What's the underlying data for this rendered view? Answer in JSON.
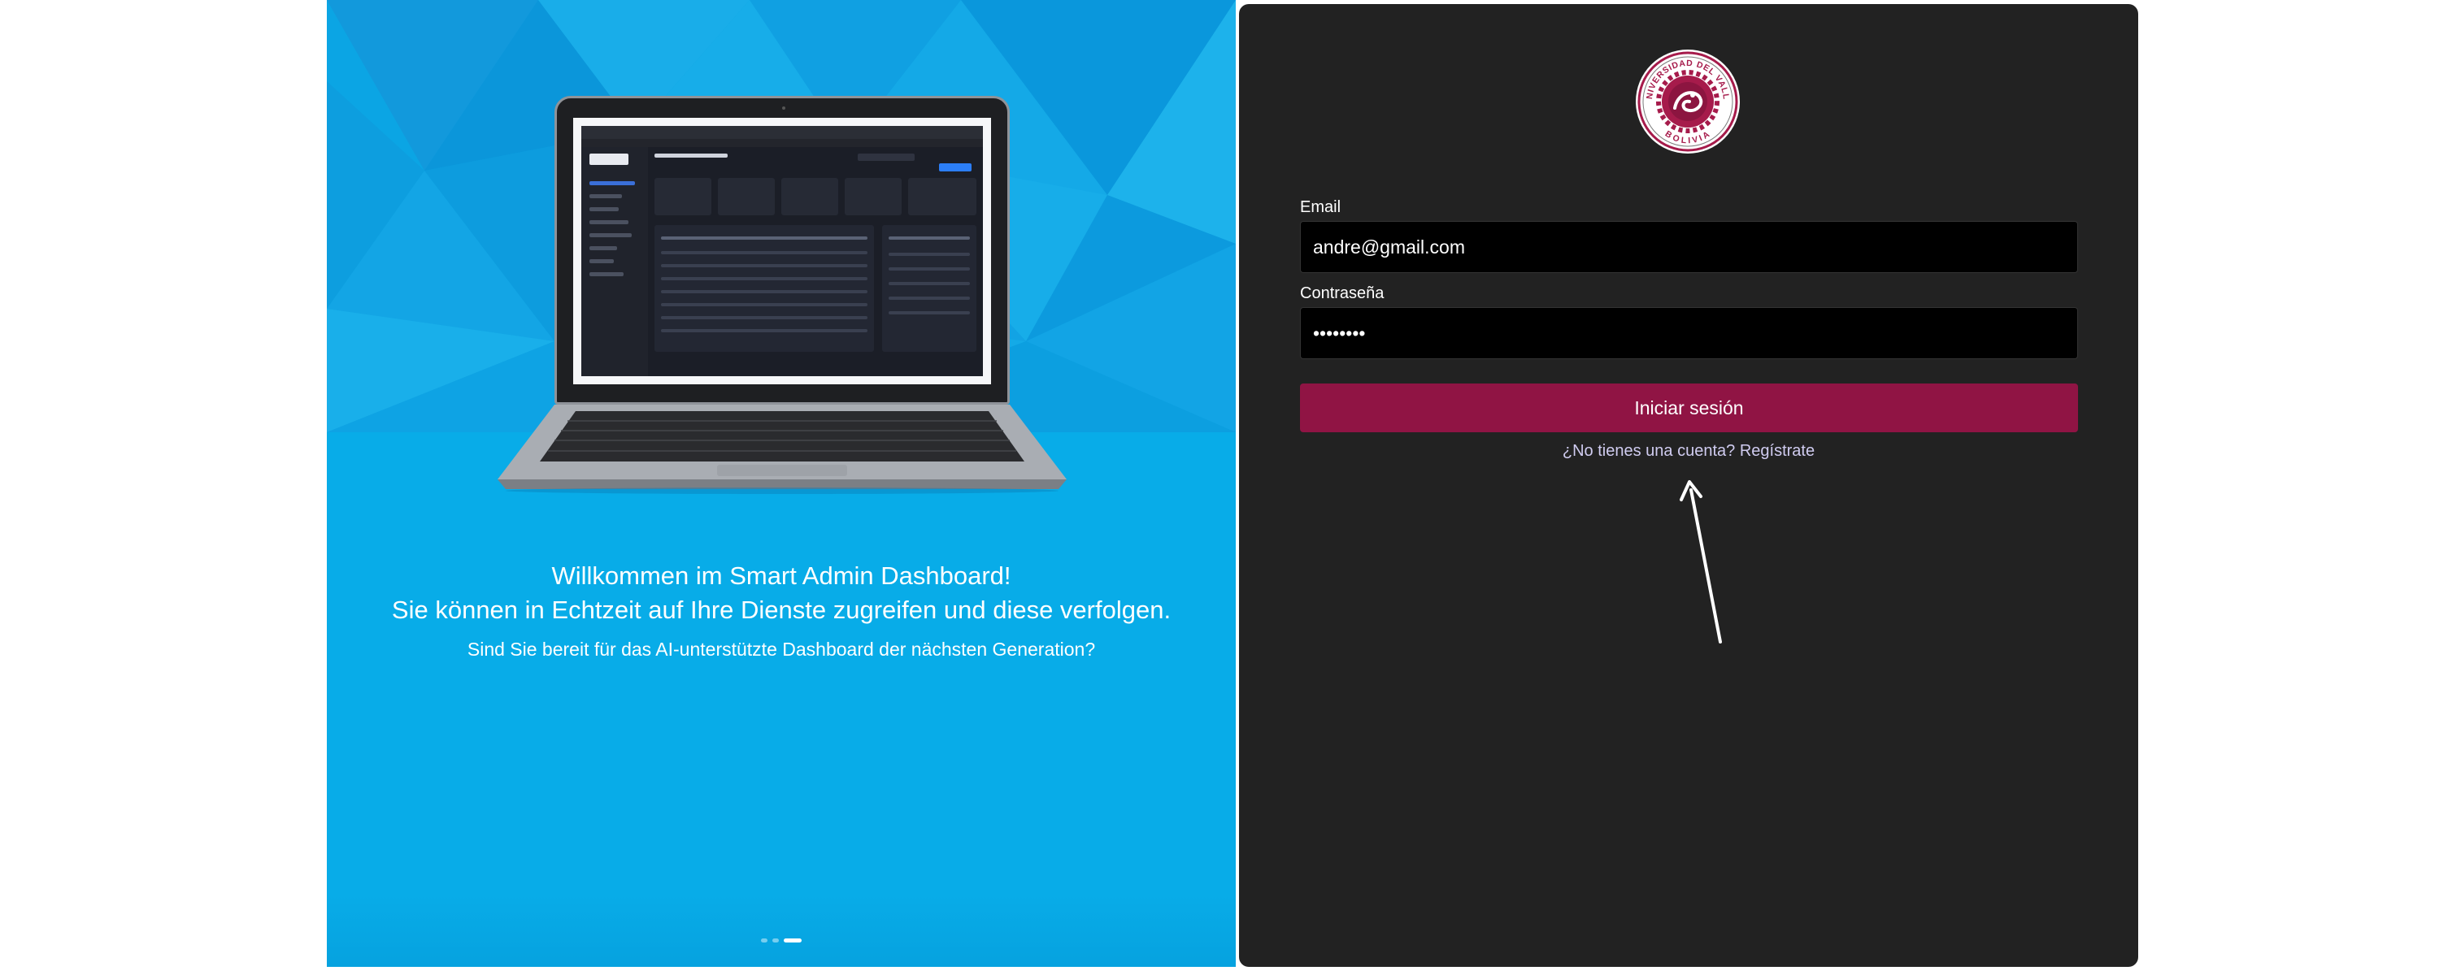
{
  "hero": {
    "title_line1": "Willkommen im Smart Admin Dashboard!",
    "title_line2": "Sie können in Echtzeit auf Ihre Dienste zugreifen und diese verfolgen.",
    "subtitle": "Sind Sie bereit für das AI-unterstützte Dashboard der nächsten Generation?",
    "carousel": {
      "slides": 3,
      "active_index": 2
    },
    "colors": {
      "background": "#08ace8",
      "text": "#ffffff"
    }
  },
  "login": {
    "logo": {
      "top_text": "UNIVERSIDAD DEL VALLE",
      "bottom_text": "BOLIVIA"
    },
    "email": {
      "label": "Email",
      "value": "andre@gmail.com"
    },
    "password": {
      "label": "Contraseña",
      "value": "••••••••"
    },
    "submit_label": "Iniciar sesión",
    "signup": {
      "prompt": "¿No tienes una cuenta?",
      "link_label": "Regístrate"
    },
    "colors": {
      "panel": "#222222",
      "input": "#000000",
      "button": "#901444",
      "link": "#d0ccf0"
    }
  },
  "icons": {
    "annotation": "arrow-up-icon",
    "logo": "university-seal-icon",
    "illustration": "laptop-icon"
  }
}
